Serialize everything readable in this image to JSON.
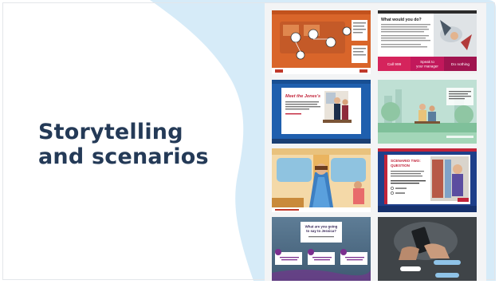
{
  "slide": {
    "title_line1": "Storytelling",
    "title_line2": "and scenarios"
  },
  "thumbnails": {
    "t2": {
      "heading": "What would you do?",
      "option_1": "Call 999",
      "option_2_line1": "Speak to",
      "option_2_line2": "your manager",
      "option_3": "Do nothing"
    },
    "t3": {
      "heading": "Meet the Jones's"
    },
    "t6": {
      "heading_line1": "SCENARIO TWO:",
      "heading_line2": "QUESTION"
    },
    "t7": {
      "heading_line1": "What are you going",
      "heading_line2": "to say to Jessica?"
    }
  },
  "colors": {
    "title": "#243a57",
    "blob": "#d6ebf8",
    "accent_purple": "#7b2f8f",
    "accent_blue": "#1f5fae"
  }
}
